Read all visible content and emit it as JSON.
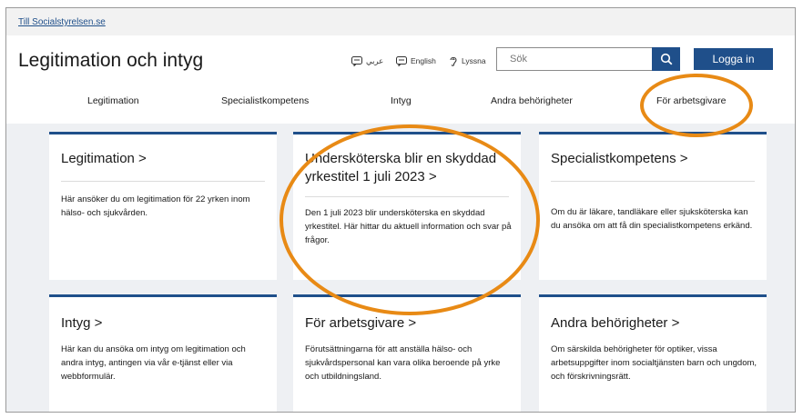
{
  "topbar": {
    "link": "Till Socialstyrelsen.se"
  },
  "header": {
    "title": "Legitimation och intyg",
    "languages": [
      {
        "label": "عربي",
        "icon": "arabic-language-icon"
      },
      {
        "label": "English",
        "icon": "english-language-icon"
      },
      {
        "label": "Lyssna",
        "icon": "listen-ear-icon"
      }
    ],
    "search": {
      "placeholder": "Sök"
    },
    "login_label": "Logga in"
  },
  "nav": {
    "items": [
      "Legitimation",
      "Specialistkompetens",
      "Intyg",
      "Andra behörigheter",
      "För arbetsgivare"
    ]
  },
  "cards": [
    {
      "title": "Legitimation >",
      "desc": "Här ansöker du om legitimation för 22 yrken inom hälso- och sjukvården."
    },
    {
      "title": "Undersköterska blir en skyddad yrkestitel 1 juli 2023 >",
      "desc": "Den 1 juli 2023 blir undersköterska en skyddad yrkestitel. Här hittar du aktuell information och svar på frågor."
    },
    {
      "title": "Specialistkompetens >",
      "desc": "Om du är läkare, tandläkare eller sjuksköterska kan du ansöka om att få din specialistkompetens erkänd."
    },
    {
      "title": "Intyg >",
      "desc": "Här kan du ansöka om intyg om legitimation och andra intyg, antingen via vår e-tjänst eller via webbformulär."
    },
    {
      "title": "För arbetsgivare >",
      "desc": "Förutsättningarna för att anställa hälso- och sjukvårdspersonal kan vara olika beroende på yrke och utbildningsland."
    },
    {
      "title": "Andra behörigheter >",
      "desc": "Om särskilda behörigheter för optiker, vissa arbetsuppgifter inom socialtjänsten barn och ungdom, och förskrivningsrätt."
    }
  ],
  "colors": {
    "primary": "#1f4f8a",
    "highlight": "#e88a15",
    "background": "#eef0f3"
  }
}
